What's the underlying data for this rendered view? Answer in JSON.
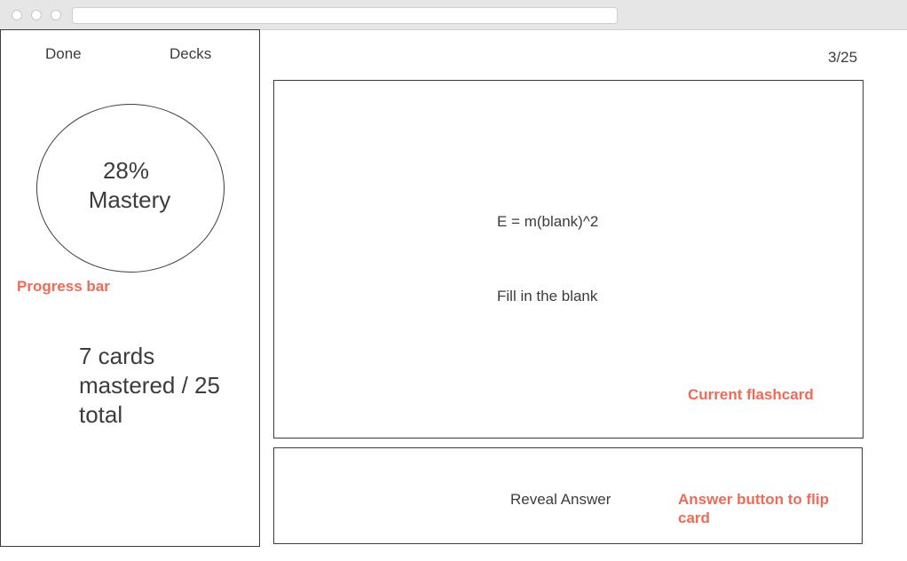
{
  "sidebar": {
    "done_label": "Done",
    "decks_label": "Decks",
    "mastery": {
      "percent_text": "28%",
      "label": "Mastery"
    },
    "progress_bar_annotation": "Progress bar",
    "mastered_summary": "7 cards mastered / 25 total"
  },
  "main": {
    "counter": "3/25",
    "flashcard": {
      "question": "E = m(blank)^2",
      "instruction": "Fill in the blank",
      "annotation": "Current flashcard"
    },
    "answer": {
      "button_label": "Reveal Answer",
      "annotation": "Answer button to flip card"
    }
  },
  "colors": {
    "annotation": "#f06a55",
    "text": "#3c3c3c",
    "chrome": "#e6e6e6"
  }
}
